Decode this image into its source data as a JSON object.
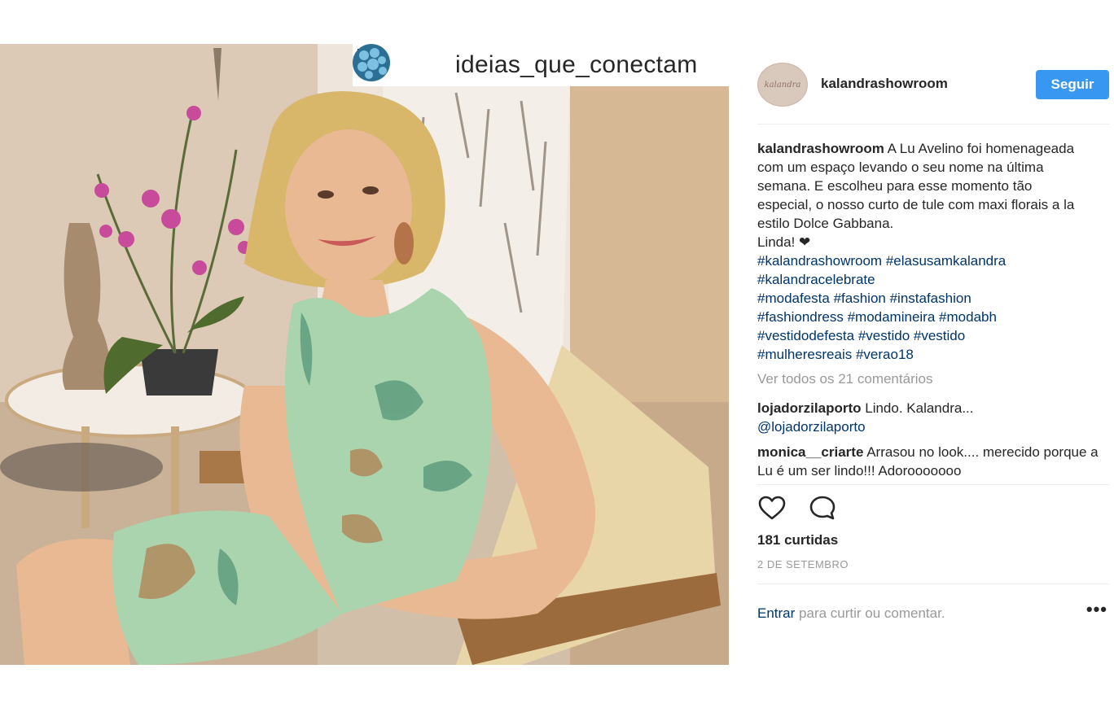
{
  "photo": {
    "description_icon": "post-photo",
    "regram": {
      "icon": "repost-icon",
      "account": "ideias_que_conectam"
    }
  },
  "post": {
    "author": "kalandrashowroom",
    "avatar_text": "kalandra",
    "follow_label": "Seguir",
    "caption": {
      "username": "kalandrashowroom",
      "text": "A Lu Avelino foi homenageada com um espaço levando o seu nome na última semana. E escolheu para esse momento tão especial, o nosso curto de tule com maxi florais a la estilo Dolce Gabbana.",
      "line2": "Linda! ❤",
      "hashtags": [
        "#kalandrashowroom",
        "#elasusamkalandra",
        "#kalandracelebrate",
        "#modafesta",
        "#fashion",
        "#instafashion",
        "#fashiondress",
        "#modamineira",
        "#modabh",
        "#vestidodefesta",
        "#vestido",
        "#vestido",
        "#mulheresreais",
        "#verao18"
      ]
    },
    "view_all_comments": "Ver todos os 21 comentários",
    "comments": [
      {
        "username": "lojadorzilaporto",
        "text": "Lindo. Kalandra...",
        "mention": "@lojadorzilaporto"
      },
      {
        "username": "monica__criarte",
        "text": "Arrasou no look.... merecido porque a Lu é um ser lindo!!! Adorooooooo"
      }
    ],
    "likes": "181 curtidas",
    "date": "2 DE SETEMBRO",
    "footer": {
      "login": "Entrar",
      "prompt": "para curtir ou comentar.",
      "more": "•••"
    }
  },
  "colors": {
    "accent": "#3897f0",
    "link": "#003569",
    "muted": "#999999"
  }
}
